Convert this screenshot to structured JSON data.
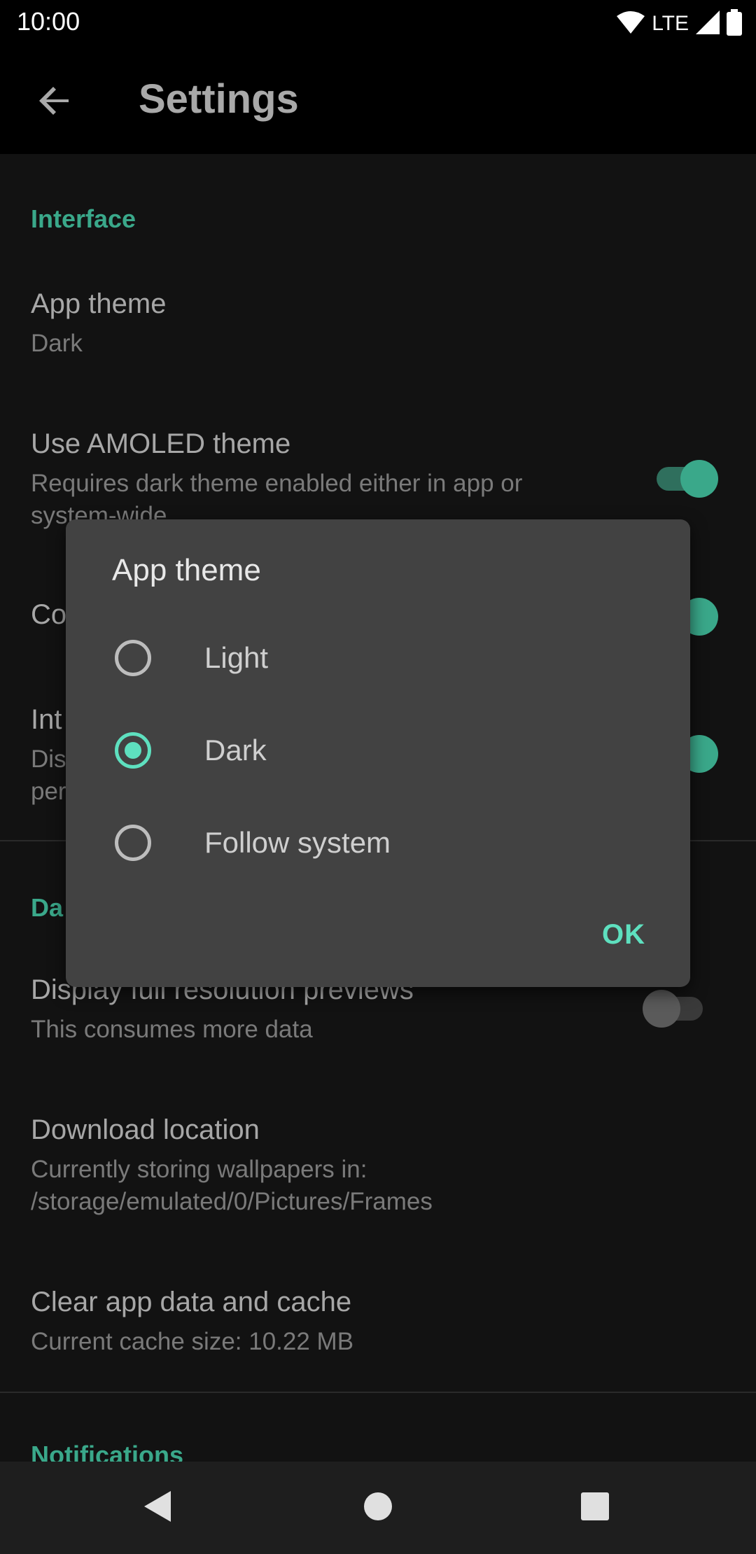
{
  "status_bar": {
    "time": "10:00",
    "network": "LTE",
    "icons": [
      "wifi-icon",
      "signal-icon",
      "battery-icon"
    ]
  },
  "app_bar": {
    "title": "Settings",
    "back_icon": "arrow-back-icon"
  },
  "settings": {
    "interface_header": "Interface",
    "app_theme": {
      "title": "App theme",
      "summary": "Dark"
    },
    "amoled": {
      "title": "Use AMOLED theme",
      "summary_line1": "Requires dark theme enabled either in app or",
      "summary_line2": "system-wide",
      "enabled": true
    },
    "colored_partial": {
      "title": "Co",
      "enabled": true
    },
    "interface_partial": {
      "title": "Int",
      "summary_line1": "Dis",
      "summary_line2": "per",
      "enabled": true
    },
    "data_header_partial": "Da",
    "full_res": {
      "title": "Display full resolution previews",
      "summary": "This consumes more data",
      "enabled": false
    },
    "download_location": {
      "title": "Download location",
      "summary_line1": "Currently storing wallpapers in:",
      "summary_line2": "/storage/emulated/0/Pictures/Frames"
    },
    "clear_cache": {
      "title": "Clear app data and cache",
      "summary": "Current cache size: 10.22 MB"
    },
    "notifications_header": "Notifications"
  },
  "dialog": {
    "title": "App theme",
    "options": [
      {
        "label": "Light",
        "selected": false
      },
      {
        "label": "Dark",
        "selected": true
      },
      {
        "label": "Follow system",
        "selected": false
      }
    ],
    "ok_label": "OK"
  },
  "colors": {
    "accent": "#5ee0bf",
    "section_header": "#3aa88a",
    "background": "#121212",
    "dialog_background": "#424242"
  },
  "nav_bar": {
    "icons": [
      "nav-back-icon",
      "nav-home-icon",
      "nav-recents-icon"
    ]
  }
}
